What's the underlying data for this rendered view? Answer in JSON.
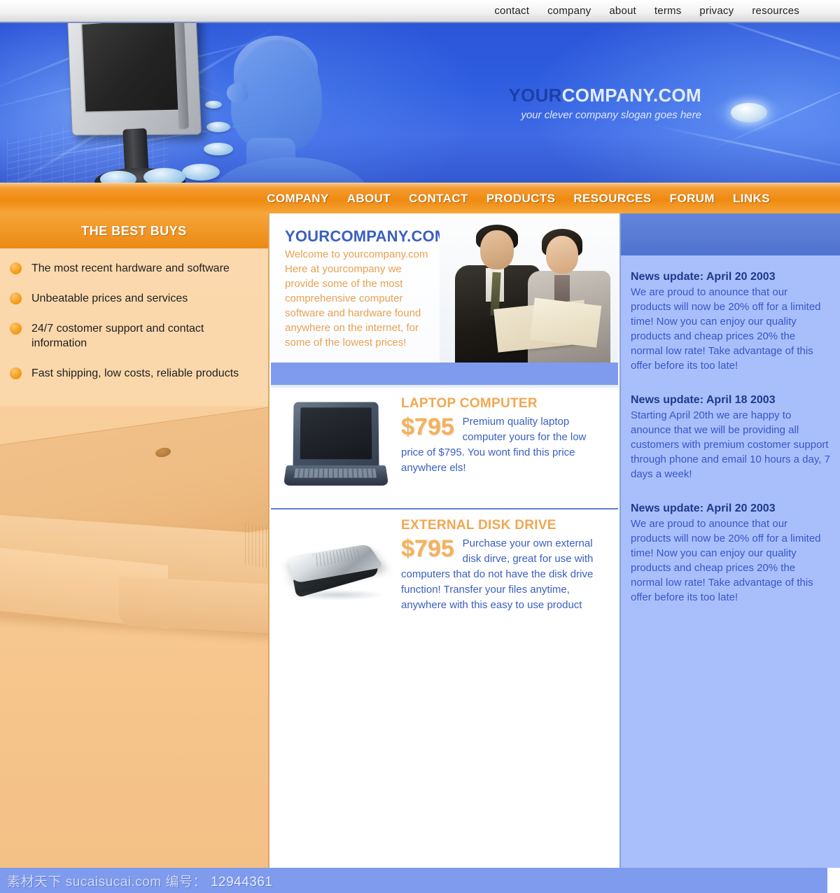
{
  "topnav": {
    "items": [
      {
        "label": "contact"
      },
      {
        "label": "company"
      },
      {
        "label": "about"
      },
      {
        "label": "terms"
      },
      {
        "label": "privacy"
      },
      {
        "label": "resources"
      }
    ]
  },
  "brand": {
    "title_part1": "YOUR",
    "title_part2": "COMPANY.COM",
    "slogan": "your clever company slogan goes here",
    "accent_blue": "#3a5fc0",
    "accent_orange": "#ef8a10"
  },
  "mainnav": {
    "items": [
      {
        "label": "COMPANY"
      },
      {
        "label": "ABOUT"
      },
      {
        "label": "CONTACT"
      },
      {
        "label": "PRODUCTS"
      },
      {
        "label": "RESOURCES"
      },
      {
        "label": "FORUM"
      },
      {
        "label": "LINKS"
      }
    ]
  },
  "sidebar": {
    "title": "THE BEST BUYS",
    "bullets": [
      {
        "text": "The most recent hardware and software"
      },
      {
        "text": "Unbeatable prices and services"
      },
      {
        "text": "24/7 costomer support and contact information"
      },
      {
        "text": "Fast shipping, low costs, reliable products"
      }
    ],
    "image_alt": "computer-case-photo"
  },
  "welcome": {
    "heading": "YOURCOMPANY.COM",
    "body": "Welcome to yourcompany.com Here at yourcompany we provide some of the most comprehensive computer software and hardware found anywhere on the internet, for some of the lowest prices!",
    "image_alt": "two-businesspeople-photo"
  },
  "products": [
    {
      "title": "LAPTOP COMPUTER",
      "price": "$795",
      "description": "Premium quality laptop computer yours for the low price of $795. You wont find this price anywhere els!",
      "image_alt": "laptop-computer-photo"
    },
    {
      "title": "EXTERNAL DISK DRIVE",
      "price": "$795",
      "description": "Purchase your own external disk dirve, great for use with computers that do not have the disk drive function! Transfer your files anytime, anywhere with this easy to use product",
      "image_alt": "external-disk-drive-photo"
    }
  ],
  "news": [
    {
      "heading": "News update: April 20 2003",
      "body": "We are proud to anounce that our products will now be 20% off for a limited time! Now you can enjoy our quality products and cheap prices 20% the normal low rate! Take advantage of this offer before its too late!"
    },
    {
      "heading": "News update: April 18 2003",
      "body": "Starting April 20th we are happy to anounce that we will be providing all customers with premium costomer support through phone and email 10 hours a day, 7 days a week!"
    },
    {
      "heading": "News update: April 20 2003",
      "body": "We are proud to anounce that our products will now be 20% off for a limited time! Now you can enjoy our quality products and cheap prices 20% the normal low rate! Take advantage of this offer before its too late!"
    }
  ],
  "footer": {
    "watermark": "素材天下 sucaisucai.com   编号：",
    "id": "12944361"
  }
}
